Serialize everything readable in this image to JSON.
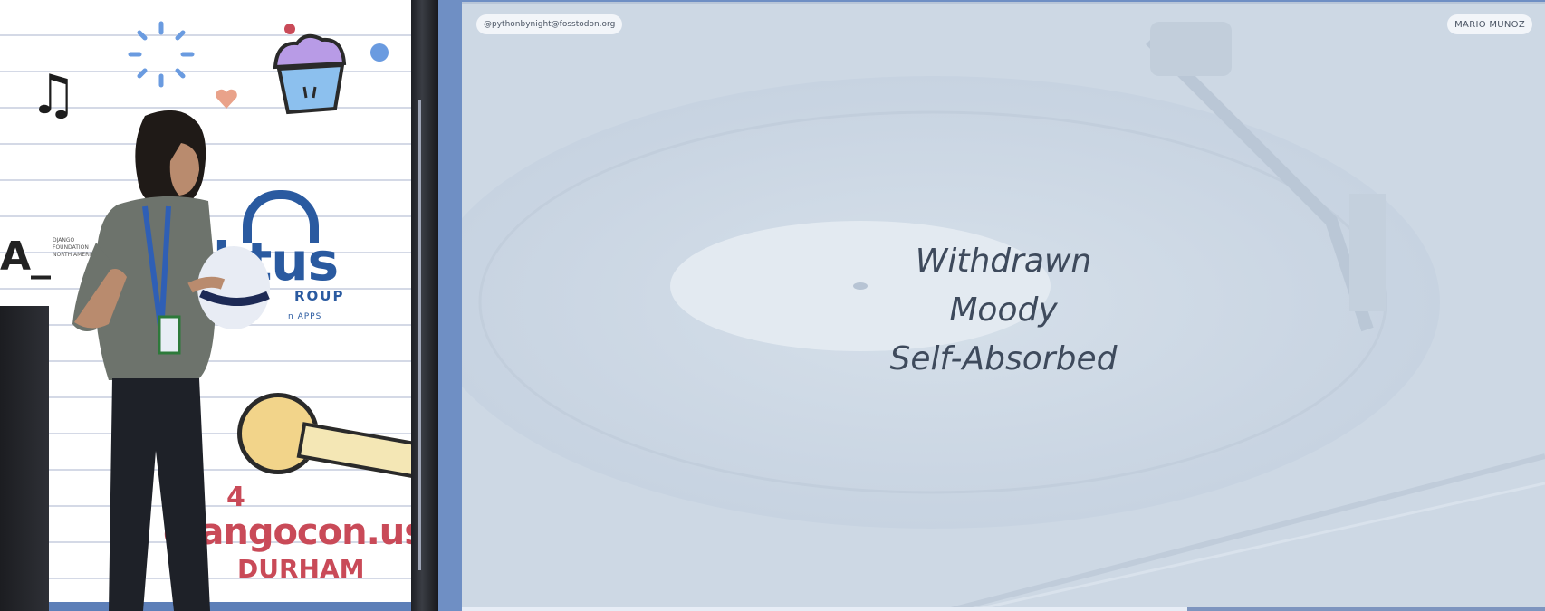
{
  "stage_backdrop": {
    "sponsor_name": "ktus",
    "sponsor_line": "ROUP",
    "sponsor_tagline": "n APPS",
    "foundation_text": "DJANGO FOUNDATION NORTH AMERICA",
    "partial_letter": "A_",
    "conference_year": "4",
    "conference_url": "djangocon.us",
    "conference_city": "DURHAM"
  },
  "slide": {
    "handle": "@pythonbynight@fosstodon.org",
    "author": "MARIO MUNOZ",
    "lines": [
      "Withdrawn",
      "Moody",
      "Self-Absorbed"
    ],
    "progress": 0.67
  },
  "colors": {
    "frame_blue": "#6f8fc4",
    "slide_bg": "#cfdae6",
    "slide_text": "#3e4a5c",
    "brand_red": "#c94a58",
    "sponsor_blue": "#2a5aa0"
  }
}
